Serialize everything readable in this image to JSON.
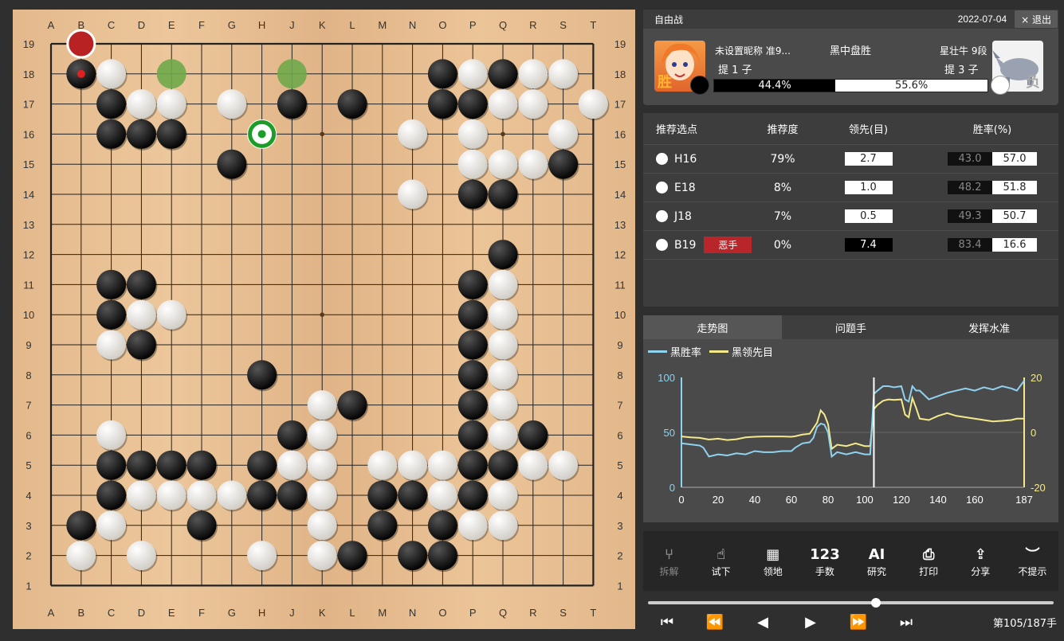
{
  "board": {
    "columns": [
      "A",
      "B",
      "C",
      "D",
      "E",
      "F",
      "G",
      "H",
      "J",
      "K",
      "L",
      "M",
      "N",
      "O",
      "P",
      "Q",
      "R",
      "S",
      "T"
    ],
    "rows": [
      "19",
      "18",
      "17",
      "16",
      "15",
      "14",
      "13",
      "12",
      "11",
      "10",
      "9",
      "8",
      "7",
      "6",
      "5",
      "4",
      "3",
      "2",
      "1"
    ],
    "black": [
      "B18",
      "C17",
      "J17",
      "L17",
      "O18",
      "O17",
      "P17",
      "Q18",
      "C16",
      "D16",
      "E16",
      "G15",
      "S15",
      "P14",
      "Q14",
      "Q12",
      "C11",
      "D11",
      "P11",
      "C10",
      "P10",
      "D9",
      "P9",
      "H8",
      "P8",
      "L7",
      "P7",
      "J6",
      "P6",
      "R6",
      "C5",
      "D5",
      "E5",
      "F5",
      "H5",
      "P5",
      "Q5",
      "C4",
      "H4",
      "J4",
      "M4",
      "N4",
      "P4",
      "B3",
      "F3",
      "M3",
      "O3",
      "L2",
      "N2",
      "O2"
    ],
    "white": [
      "C18",
      "P18",
      "R18",
      "S18",
      "D17",
      "E17",
      "G17",
      "Q17",
      "R17",
      "T17",
      "N16",
      "P16",
      "S16",
      "P15",
      "Q15",
      "R15",
      "N14",
      "Q11",
      "D10",
      "E10",
      "Q10",
      "C9",
      "Q9",
      "Q8",
      "K7",
      "Q7",
      "C6",
      "K6",
      "Q6",
      "J5",
      "K5",
      "M5",
      "N5",
      "O5",
      "R5",
      "S5",
      "D4",
      "E4",
      "F4",
      "G4",
      "K4",
      "O4",
      "Q4",
      "C3",
      "K3",
      "P3",
      "Q3",
      "B2",
      "D2",
      "H2",
      "K2"
    ],
    "last_move": "B18",
    "suggestion_red": "B19",
    "suggestion_green": [
      "E18",
      "J18"
    ],
    "highlight_ring": "H16",
    "star_points": [
      "D16",
      "K16",
      "Q16",
      "D10",
      "K10",
      "Q10",
      "D4",
      "K4",
      "Q4"
    ]
  },
  "header": {
    "mode": "自由战",
    "date": "2022-07-04",
    "exit": "× 退出"
  },
  "players": {
    "black_name": "未设置昵称 准9...",
    "black_captures": "提 1 子",
    "black_badge": "胜",
    "white_name": "星壮牛 9段",
    "white_captures": "提 3 子",
    "white_badge": "负",
    "result": "黑中盘胜",
    "black_winrate": "44.4%",
    "white_winrate": "55.6%",
    "black_winrate_value": 44.4
  },
  "recommendations": {
    "headers": [
      "推荐选点",
      "推荐度",
      "领先(目)",
      "胜率(%)"
    ],
    "rows": [
      {
        "move": "H16",
        "tag": "",
        "pct": "79%",
        "lead": "2.7",
        "lead_dark": false,
        "b": "43.0",
        "w": "57.0"
      },
      {
        "move": "E18",
        "tag": "",
        "pct": "8%",
        "lead": "1.0",
        "lead_dark": false,
        "b": "48.2",
        "w": "51.8"
      },
      {
        "move": "J18",
        "tag": "",
        "pct": "7%",
        "lead": "0.5",
        "lead_dark": false,
        "b": "49.3",
        "w": "50.7"
      },
      {
        "move": "B19",
        "tag": "恶手",
        "pct": "0%",
        "lead": "7.4",
        "lead_dark": true,
        "b": "83.4",
        "w": "16.6"
      }
    ]
  },
  "tabs": [
    "走势图",
    "问题手",
    "发挥水准"
  ],
  "chart_data": {
    "type": "line",
    "legend": [
      "黑胜率",
      "黑领先目"
    ],
    "colors": {
      "winrate": "#8fd3f0",
      "lead": "#f5e98a"
    },
    "x_ticks": [
      "0",
      "20",
      "40",
      "60",
      "80",
      "100",
      "120",
      "140",
      "160",
      "187"
    ],
    "x_range": [
      0,
      187
    ],
    "y_left_ticks": [
      "100",
      "50",
      "0"
    ],
    "y_left_range": [
      0,
      100
    ],
    "y_right_ticks": [
      "20",
      "0",
      "-20"
    ],
    "y_right_range": [
      -20,
      20
    ],
    "current_move": 105,
    "series": [
      {
        "name": "黑胜率",
        "x": [
          0,
          5,
          10,
          12,
          15,
          20,
          25,
          30,
          35,
          40,
          45,
          50,
          55,
          60,
          62,
          66,
          70,
          72,
          74,
          76,
          78,
          80,
          82,
          85,
          90,
          95,
          100,
          103,
          105,
          107,
          110,
          113,
          116,
          120,
          122,
          124,
          126,
          128,
          130,
          135,
          140,
          145,
          150,
          155,
          160,
          165,
          170,
          175,
          180,
          183,
          187
        ],
        "values": [
          40,
          39,
          38,
          36,
          28,
          30,
          29,
          31,
          30,
          33,
          32,
          32,
          33,
          33,
          36,
          40,
          41,
          45,
          55,
          58,
          57,
          50,
          28,
          32,
          30,
          32,
          30,
          30,
          85,
          88,
          92,
          92,
          91,
          92,
          80,
          78,
          92,
          88,
          88,
          80,
          83,
          86,
          88,
          90,
          88,
          91,
          89,
          92,
          90,
          88,
          97
        ]
      },
      {
        "name": "黑领先目",
        "x": [
          0,
          5,
          10,
          15,
          20,
          25,
          30,
          35,
          40,
          45,
          50,
          55,
          60,
          62,
          66,
          70,
          72,
          74,
          76,
          78,
          80,
          82,
          85,
          90,
          95,
          100,
          103,
          105,
          107,
          110,
          113,
          116,
          120,
          122,
          124,
          126,
          128,
          130,
          135,
          140,
          145,
          150,
          155,
          160,
          165,
          170,
          175,
          180,
          183,
          187
        ],
        "values": [
          -1.5,
          -1.8,
          -2.0,
          -2.6,
          -2.3,
          -2.8,
          -2.5,
          -1.8,
          -1.6,
          -1.5,
          -1.5,
          -1.5,
          -1.6,
          -1.4,
          -0.8,
          -0.5,
          1.5,
          3.5,
          8.0,
          6.5,
          3.0,
          -6.0,
          -4.5,
          -5.0,
          -4.0,
          -5.0,
          -5.0,
          8.5,
          10.0,
          11.5,
          12.0,
          11.8,
          12.0,
          6.5,
          5.5,
          12.5,
          9.0,
          5.0,
          4.5,
          6.0,
          7.0,
          6.0,
          5.5,
          5.0,
          4.5,
          4.0,
          4.2,
          4.5,
          5.0,
          5.0
        ]
      }
    ]
  },
  "toolbar": [
    {
      "label": "拆解",
      "icon": "branch-icon",
      "glyph": "⑂",
      "enabled": false
    },
    {
      "label": "试下",
      "icon": "hand-pointer-icon",
      "glyph": "☝",
      "enabled": true
    },
    {
      "label": "领地",
      "icon": "calculator-icon",
      "glyph": "▦",
      "enabled": true
    },
    {
      "label": "手数",
      "icon": "numbers-icon",
      "glyph": "123",
      "enabled": true
    },
    {
      "label": "研究",
      "icon": "ai-icon",
      "glyph": "AI",
      "enabled": true
    },
    {
      "label": "打印",
      "icon": "printer-icon",
      "glyph": "⎙",
      "enabled": true
    },
    {
      "label": "分享",
      "icon": "share-icon",
      "glyph": "⇪",
      "enabled": true
    },
    {
      "label": "不提示",
      "icon": "eye-closed-icon",
      "glyph": "︶",
      "enabled": true
    }
  ],
  "navigation": {
    "current": 105,
    "total": 187,
    "counter": "第105/187手",
    "buttons": [
      {
        "name": "first-move-button",
        "glyph": "⏮"
      },
      {
        "name": "rewind-button",
        "glyph": "⏪"
      },
      {
        "name": "prev-move-button",
        "glyph": "◀"
      },
      {
        "name": "next-move-button",
        "glyph": "▶"
      },
      {
        "name": "fast-forward-button",
        "glyph": "⏩"
      },
      {
        "name": "last-move-button",
        "glyph": "⏭"
      }
    ]
  }
}
